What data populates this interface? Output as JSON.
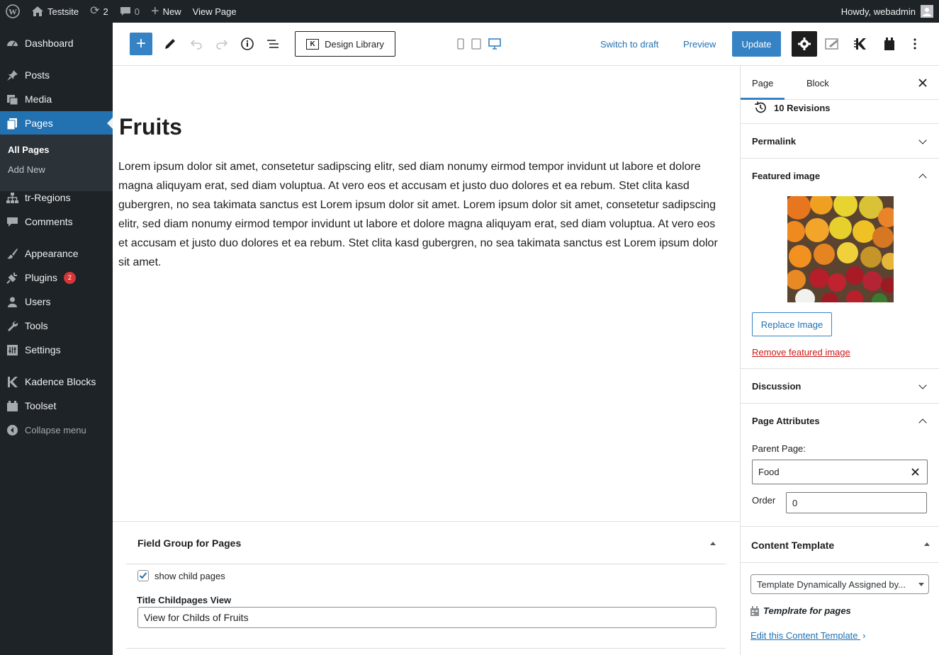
{
  "admin_bar": {
    "site_name": "Testsite",
    "updates_count": "2",
    "comments_count": "0",
    "new_label": "New",
    "view_page_label": "View Page",
    "howdy": "Howdy, webadmin"
  },
  "sidebar": {
    "items": [
      {
        "label": "Dashboard",
        "icon": "dashboard-icon"
      },
      {
        "label": "Posts",
        "icon": "pin-icon"
      },
      {
        "label": "Media",
        "icon": "media-icon"
      },
      {
        "label": "Pages",
        "icon": "pages-icon"
      },
      {
        "label": "tr-Regions",
        "icon": "sitemap-icon"
      },
      {
        "label": "Comments",
        "icon": "comment-icon"
      },
      {
        "label": "Appearance",
        "icon": "brush-icon"
      },
      {
        "label": "Plugins",
        "icon": "plugin-icon",
        "badge": "2"
      },
      {
        "label": "Users",
        "icon": "user-icon"
      },
      {
        "label": "Tools",
        "icon": "wrench-icon"
      },
      {
        "label": "Settings",
        "icon": "settings-icon"
      },
      {
        "label": "Kadence Blocks",
        "icon": "kadence-icon"
      },
      {
        "label": "Toolset",
        "icon": "toolset-icon"
      }
    ],
    "submenu": [
      "All Pages",
      "Add New"
    ],
    "collapse_label": "Collapse menu"
  },
  "toolbar": {
    "design_library_label": "Design Library",
    "switch_to_draft_label": "Switch to draft",
    "preview_label": "Preview",
    "update_label": "Update"
  },
  "editor": {
    "title": "Fruits",
    "body": "Lorem ipsum dolor sit amet, consetetur sadipscing elitr, sed diam nonumy eirmod tempor invidunt ut labore et dolore magna aliquyam erat, sed diam voluptua. At vero eos et accusam et justo duo dolores et ea rebum. Stet clita kasd gubergren, no sea takimata sanctus est Lorem ipsum dolor sit amet. Lorem ipsum dolor sit amet, consetetur sadipscing elitr, sed diam nonumy eirmod tempor invidunt ut labore et dolore magna aliquyam erat, sed diam voluptua. At vero eos et accusam et justo duo dolores et ea rebum. Stet clita kasd gubergren, no sea takimata sanctus est Lorem ipsum dolor sit amet."
  },
  "metabox": {
    "title": "Field Group for Pages",
    "checkbox_label": "show child pages",
    "checkbox_checked": true,
    "field_label": "Title Childpages View",
    "field_value": "View for Childs of Fruits"
  },
  "settings": {
    "tabs": [
      "Page",
      "Block"
    ],
    "revisions": "10 Revisions",
    "permalink": "Permalink",
    "featured_image": "Featured image",
    "replace_image": "Replace Image",
    "remove_featured_image": "Remove featured image",
    "discussion": "Discussion",
    "page_attributes": "Page Attributes",
    "parent_page_label": "Parent Page:",
    "parent_page_value": "Food",
    "order_label": "Order",
    "order_value": "0",
    "content_template": "Content Template",
    "template_select": "Template Dynamically Assigned by...",
    "template_name": "Templrate for pages",
    "edit_template": "Edit this Content Template"
  },
  "colors": {
    "admin_dark": "#1d2327",
    "accent": "#3582c4",
    "link": "#2271b1",
    "danger": "#cc1818"
  }
}
